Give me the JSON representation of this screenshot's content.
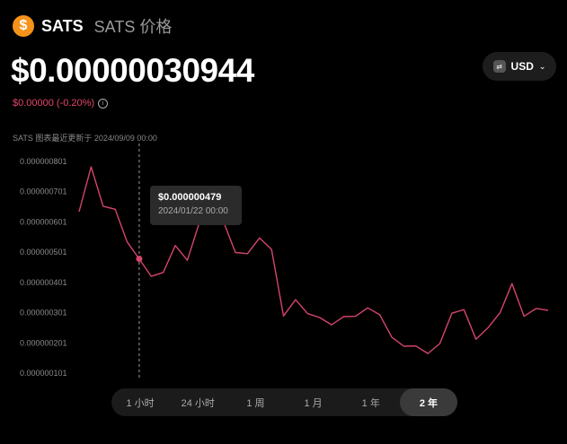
{
  "header": {
    "icon": "dollar-coin-icon",
    "icon_glyph": "$",
    "symbol": "SATS",
    "name": "SATS 价格"
  },
  "price": "$0.00000030944",
  "change": "$0.00000 (-0.20%)",
  "change_color": "#e5466a",
  "info_glyph": "i",
  "currency": {
    "label": "USD",
    "icon": "currency-icon",
    "icon_glyph": "⇄",
    "chevron": "⌄"
  },
  "chart_caption": "SATS 图表最近更新于 2024/09/09 00:00",
  "tooltip": {
    "value": "$0.000000479",
    "date": "2024/01/22 00:00"
  },
  "tabs": [
    {
      "label": "1 小时",
      "active": false
    },
    {
      "label": "24 小时",
      "active": false
    },
    {
      "label": "1 周",
      "active": false
    },
    {
      "label": "1 月",
      "active": false
    },
    {
      "label": "1 年",
      "active": false
    },
    {
      "label": "2 年",
      "active": true
    }
  ],
  "chart_data": {
    "type": "line",
    "title": "",
    "xlabel": "",
    "ylabel": "",
    "y_ticks": [
      "0.000000801",
      "0.000000701",
      "0.000000601",
      "0.000000501",
      "0.000000401",
      "0.000000301",
      "0.000000201",
      "0.000000101"
    ],
    "y_tick_values": [
      8.01e-07,
      7.01e-07,
      6.01e-07,
      5.01e-07,
      4.01e-07,
      3.01e-07,
      2.01e-07,
      1.01e-07
    ],
    "ylim": [
      1.01e-07,
      8.01e-07
    ],
    "line_color": "#d6456a",
    "highlighted_point_index": 5,
    "values": [
      6.35e-07,
      7.83e-07,
      6.53e-07,
      6.43e-07,
      5.35e-07,
      4.79e-07,
      4.21e-07,
      4.34e-07,
      5.23e-07,
      4.74e-07,
      5.98e-07,
      6.51e-07,
      6.03e-07,
      5e-07,
      4.96e-07,
      5.48e-07,
      5.1e-07,
      2.9e-07,
      3.44e-07,
      2.98e-07,
      2.85e-07,
      2.61e-07,
      2.88e-07,
      2.89e-07,
      3.17e-07,
      2.94e-07,
      2.2e-07,
      1.9e-07,
      1.91e-07,
      1.66e-07,
      1.99e-07,
      2.99e-07,
      3.11e-07,
      2.13e-07,
      2.51e-07,
      3.01e-07,
      3.97e-07,
      2.89e-07,
      3.15e-07,
      3.09e-07
    ]
  }
}
